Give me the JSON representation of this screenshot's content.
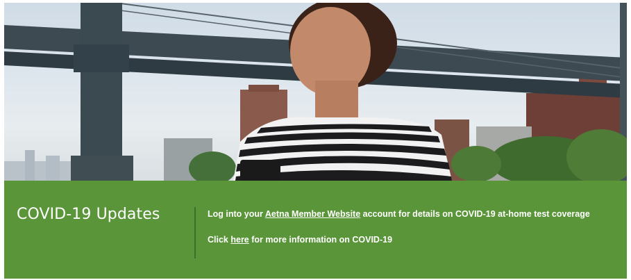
{
  "hero": {
    "image_description": ""
  },
  "banner": {
    "title": "COVID-19 Updates",
    "line1": {
      "prefix": "Log into your ",
      "link": "Aetna Member Website",
      "suffix": " account for details on COVID-19 at-home test coverage"
    },
    "line2": {
      "prefix": "Click ",
      "link": "here",
      "suffix": " for more information on COVID-19"
    }
  },
  "colors": {
    "banner_bg": "#5a9639",
    "banner_text": "#ffffff",
    "divider": "#3f6e2a"
  }
}
